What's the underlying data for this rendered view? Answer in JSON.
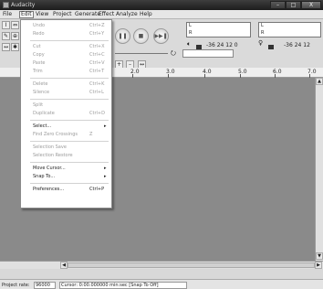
{
  "window": {
    "title": "Audacity",
    "minimize": "–",
    "maximize": "□",
    "close": "X"
  },
  "menubar": {
    "file": "File",
    "edit": "Edit",
    "view": "View",
    "project": "Project",
    "generate": "Generate",
    "effect": "Effect",
    "analyze": "Analyze",
    "help": "Help"
  },
  "toolbar": {
    "tools": {
      "selection": "I",
      "envelope": "⇔",
      "draw": "✎",
      "zoom": "⊕",
      "timeshift": "↔",
      "multi": "✱"
    },
    "transport": {
      "pause": "❚❚",
      "stop": "■",
      "skip_end": "▶▶❚"
    },
    "meters": {
      "left": "L",
      "right": "R",
      "output_icon": "speaker-icon",
      "input_icon": "microphone-icon",
      "output_scale": "-36  24  12  0",
      "input_scale": "-36  24  12"
    },
    "edit_tools": {
      "zoom_in": "+",
      "zoom_out": "–",
      "fit": "↔"
    },
    "cursor_icon": "⭮"
  },
  "ruler": {
    "ticks": [
      "2.0",
      "3.0",
      "4.0",
      "5.0",
      "6.0",
      "7.0"
    ]
  },
  "edit_menu": {
    "items": [
      {
        "label": "Undo",
        "shortcut": "Ctrl+Z",
        "disabled": true,
        "submenu": false
      },
      {
        "label": "Redo",
        "shortcut": "Ctrl+Y",
        "disabled": true,
        "submenu": false
      },
      {
        "separator": true
      },
      {
        "label": "Cut",
        "shortcut": "Ctrl+X",
        "disabled": true,
        "submenu": false
      },
      {
        "label": "Copy",
        "shortcut": "Ctrl+C",
        "disabled": true,
        "submenu": false
      },
      {
        "label": "Paste",
        "shortcut": "Ctrl+V",
        "disabled": true,
        "submenu": false
      },
      {
        "label": "Trim",
        "shortcut": "Ctrl+T",
        "disabled": true,
        "submenu": false
      },
      {
        "separator": true
      },
      {
        "label": "Delete",
        "shortcut": "Ctrl+K",
        "disabled": true,
        "submenu": false
      },
      {
        "label": "Silence",
        "shortcut": "Ctrl+L",
        "disabled": true,
        "submenu": false
      },
      {
        "separator": true
      },
      {
        "label": "Split",
        "shortcut": "",
        "disabled": true,
        "submenu": false
      },
      {
        "label": "Duplicate",
        "shortcut": "Ctrl+D",
        "disabled": true,
        "submenu": false
      },
      {
        "separator": true
      },
      {
        "label": "Select...",
        "shortcut": "",
        "disabled": false,
        "submenu": true
      },
      {
        "label": "Find Zero Crossings",
        "shortcut": "Z",
        "disabled": true,
        "submenu": false
      },
      {
        "separator": true
      },
      {
        "label": "Selection Save",
        "shortcut": "",
        "disabled": true,
        "submenu": false
      },
      {
        "label": "Selection Restore",
        "shortcut": "",
        "disabled": true,
        "submenu": false
      },
      {
        "separator": true
      },
      {
        "label": "Move Cursor...",
        "shortcut": "",
        "disabled": false,
        "submenu": true
      },
      {
        "label": "Snap To...",
        "shortcut": "",
        "disabled": false,
        "submenu": true
      },
      {
        "separator": true
      },
      {
        "label": "Preferences...",
        "shortcut": "Ctrl+P",
        "disabled": false,
        "submenu": false
      }
    ]
  },
  "statusbar": {
    "rate_label": "Project rate:",
    "rate_value": "96000",
    "cursor": "Cursor: 0:00.000000 min:sec",
    "snap": "[Snap To Off]"
  }
}
